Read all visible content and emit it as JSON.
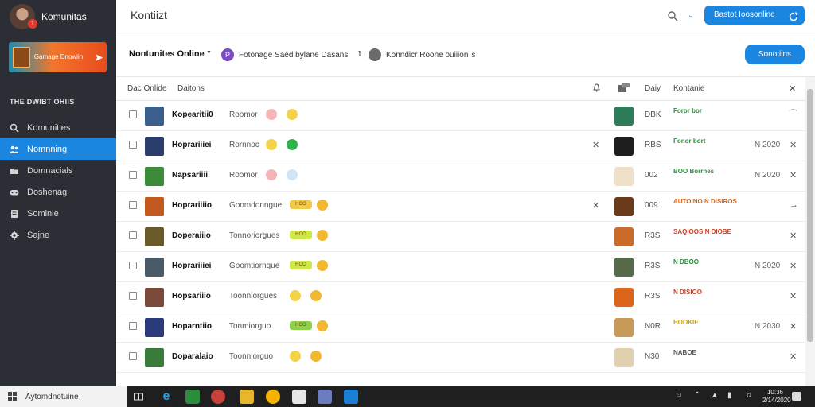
{
  "sidebar": {
    "app_name": "Komunitas",
    "badge": "1",
    "promo": {
      "text": "Gamage Dnowiin"
    },
    "section_title": "THE DWIBT OHIIS",
    "items": [
      {
        "label": "Komunities",
        "icon": "search-icon",
        "active": false
      },
      {
        "label": "Nomnning",
        "icon": "users-icon",
        "active": true
      },
      {
        "label": "Domnacials",
        "icon": "folder-icon",
        "active": false
      },
      {
        "label": "Doshenag",
        "icon": "gamepad-icon",
        "active": false
      },
      {
        "label": "Sominie",
        "icon": "document-icon",
        "active": false
      },
      {
        "label": "Sajne",
        "icon": "gear-icon",
        "active": false
      }
    ]
  },
  "topbar": {
    "title": "Kontiizt",
    "primary_button": "Bastot Ioosonline"
  },
  "filterbar": {
    "title": "Nontunites Online",
    "chip1": "Fotonage Saed bylane Dasans",
    "count": "1",
    "chip2": "Konndicr Roone ouiiion",
    "chip2_suffix": "s",
    "button": "Sonotiins"
  },
  "table": {
    "headers": {
      "col1": "Dac Onlide",
      "col2": "Daitons",
      "col_day": "Daiy",
      "col_status": "Kontanie"
    },
    "rows": [
      {
        "name": "Kopearitii0",
        "category": "Roomor",
        "badge": "",
        "day": "DBK",
        "status": "Foror bor",
        "time": ""
      },
      {
        "name": "Hoprariiiei",
        "category": "Rornnoc",
        "badge": "",
        "day": "RBS",
        "status": "Fonor bort",
        "time": "N 2020"
      },
      {
        "name": "Napsariiii",
        "category": "Roomor",
        "badge": "",
        "day": "002",
        "status": "BOO Borrnes",
        "time": "N 2020"
      },
      {
        "name": "Hoprariiiio",
        "category": "Goomdonngue",
        "badge": "HOO",
        "day": "009",
        "status": "AUTOINO N DISIROS",
        "time": ""
      },
      {
        "name": "Doperaiiio",
        "category": "Tonnoriorgues",
        "badge": "HOO",
        "day": "R3S",
        "status": "SAQIOOS N DIOBE",
        "time": ""
      },
      {
        "name": "Hoprariiiei",
        "category": "Goomtiorngue",
        "badge": "HOO",
        "day": "R3S",
        "status": "N DBOO",
        "time": "N 2020"
      },
      {
        "name": "Hopsariiio",
        "category": "Toonnlorgues",
        "badge": "",
        "day": "R3S",
        "status": "N DISIOO",
        "time": ""
      },
      {
        "name": "Hoparntiio",
        "category": "Tonmiorguo",
        "badge": "HOO",
        "day": "N0R",
        "status": "HOOKIE",
        "time": "N 2030"
      },
      {
        "name": "Doparalaio",
        "category": "Toonnlorguo",
        "badge": "",
        "day": "N30",
        "status": "NABOE",
        "time": ""
      }
    ]
  },
  "taskbar": {
    "search_text": "Aytomdnotuine",
    "clock_time": "10:36",
    "clock_date": "2/14/2020"
  }
}
